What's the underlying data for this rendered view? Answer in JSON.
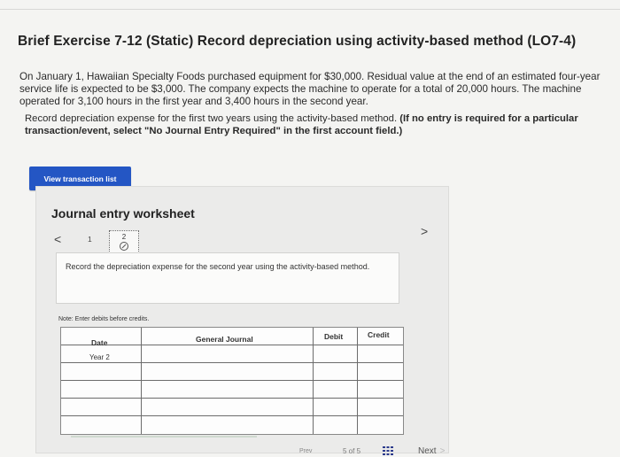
{
  "exercise": {
    "title": "Brief Exercise 7-12 (Static) Record depreciation using activity-based method (LO7-4)",
    "paragraph": "On January 1, Hawaiian Specialty Foods purchased equipment for $30,000. Residual value at the end of an estimated four-year service life is expected to be $3,000. The company expects the machine to operate for a total of 20,000 hours. The machine operated for 3,100 hours in the first year and 3,400 hours in the second year.",
    "instruction_plain": "Record depreciation expense for the first two years using the activity-based method.",
    "instruction_bold": "(If no entry is required for a particular transaction/event, select \"No Journal Entry Required\" in the first account field.)"
  },
  "buttons": {
    "view_transaction_list": "View transaction list",
    "next": "Next"
  },
  "worksheet": {
    "title": "Journal entry worksheet",
    "pager": {
      "prev": "<",
      "page1": "1",
      "page2": "2",
      "next": ">"
    },
    "instruction": "Record the depreciation expense for the second year using the activity-based method.",
    "note": "Note: Enter debits before credits.",
    "table": {
      "headers": {
        "date": "Date",
        "journal": "General Journal",
        "debit": "Debit",
        "credit": "Credit"
      },
      "date_value": "Year 2"
    }
  },
  "footer": {
    "page_count": "5 of 5",
    "truncated_label": "Prev"
  },
  "colors": {
    "primary_button": "#2456c4",
    "background": "#f4f4f2"
  },
  "icons": {
    "pencil_page_icon": "pencil-icon",
    "grid_icon": "grid-icon"
  }
}
